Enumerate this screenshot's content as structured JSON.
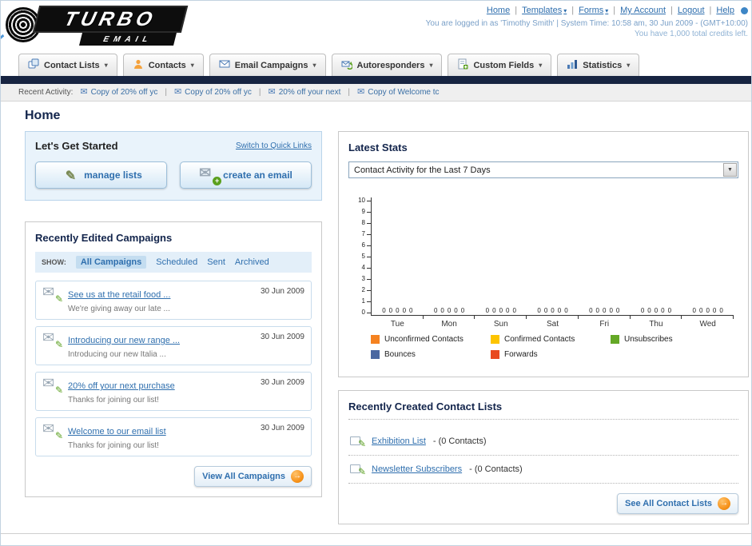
{
  "header": {
    "logo_primary": "TURBO",
    "logo_secondary": "EMAIL",
    "links": [
      {
        "label": "Home"
      },
      {
        "label": "Templates"
      },
      {
        "label": "Forms"
      },
      {
        "label": "My Account"
      },
      {
        "label": "Logout"
      },
      {
        "label": "Help"
      }
    ],
    "login_info": "You are logged in as 'Timothy Smith' | System Time: 10:58 am, 30 Jun 2009 - (GMT+10:00)",
    "credits": "You have 1,000 total credits left."
  },
  "nav": {
    "tabs": [
      {
        "label": "Contact Lists"
      },
      {
        "label": "Contacts"
      },
      {
        "label": "Email Campaigns"
      },
      {
        "label": "Autoresponders"
      },
      {
        "label": "Custom Fields"
      },
      {
        "label": "Statistics"
      }
    ]
  },
  "activity": {
    "label": "Recent Activity:",
    "items": [
      "Copy of 20% off yc",
      "Copy of 20% off yc",
      "20% off your next",
      "Copy of Welcome tc"
    ]
  },
  "page_title": "Home",
  "get_started": {
    "title": "Let's Get Started",
    "switch_link": "Switch to Quick Links",
    "manage_lists": "manage lists",
    "create_email": "create an email"
  },
  "campaigns": {
    "title": "Recently Edited Campaigns",
    "show_label": "SHOW:",
    "tabs": [
      "All Campaigns",
      "Scheduled",
      "Sent",
      "Archived"
    ],
    "selected_tab": "All Campaigns",
    "items": [
      {
        "title": "See us at the retail food ...",
        "subtitle": "We're giving away our late ...",
        "date": "30 Jun 2009"
      },
      {
        "title": "Introducing our new range ...",
        "subtitle": "Introducing our new Italia ...",
        "date": "30 Jun 2009"
      },
      {
        "title": "20% off your next purchase",
        "subtitle": "Thanks for joining our list!",
        "date": "30 Jun 2009"
      },
      {
        "title": "Welcome to our email list",
        "subtitle": "Thanks for joining our list!",
        "date": "30 Jun 2009"
      }
    ],
    "view_all": "View All Campaigns"
  },
  "stats": {
    "title": "Latest Stats",
    "dropdown_value": "Contact Activity for the Last 7 Days",
    "chart_data": {
      "type": "bar",
      "title": "Contact Activity for the Last 7 Days",
      "categories": [
        "Tue",
        "Mon",
        "Sun",
        "Sat",
        "Fri",
        "Thu",
        "Wed"
      ],
      "series": [
        {
          "name": "Unconfirmed Contacts",
          "color": "#f58220",
          "values": [
            0,
            0,
            0,
            0,
            0,
            0,
            0
          ]
        },
        {
          "name": "Confirmed Contacts",
          "color": "#fdc400",
          "values": [
            0,
            0,
            0,
            0,
            0,
            0,
            0
          ]
        },
        {
          "name": "Unsubscribes",
          "color": "#64a826",
          "values": [
            0,
            0,
            0,
            0,
            0,
            0,
            0
          ]
        },
        {
          "name": "Bounces",
          "color": "#4a67a0",
          "values": [
            0,
            0,
            0,
            0,
            0,
            0,
            0
          ]
        },
        {
          "name": "Forwards",
          "color": "#e8491f",
          "values": [
            0,
            0,
            0,
            0,
            0,
            0,
            0
          ]
        }
      ],
      "ylim": [
        0,
        10
      ],
      "ytick_step": 1,
      "grid": false,
      "legend_position": "bottom",
      "value_labels": true
    }
  },
  "contact_lists": {
    "title": "Recently Created Contact Lists",
    "items": [
      {
        "name": "Exhibition List",
        "count": "- (0 Contacts)"
      },
      {
        "name": "Newsletter Subscribers",
        "count": "- (0 Contacts)"
      }
    ],
    "see_all": "See All Contact Lists"
  },
  "icons": {
    "caret": "▾",
    "select_caret": "▼",
    "envelope": "✉",
    "pencil": "✎",
    "arrow_right": "→",
    "plus": "+"
  },
  "ui": {
    "separator": "|"
  },
  "colors": {
    "accent_blue": "#2f6fae",
    "dark_navy": "#172441",
    "orange_action": "#f7941d",
    "panel_blue_bg": "#e9f3fb"
  }
}
